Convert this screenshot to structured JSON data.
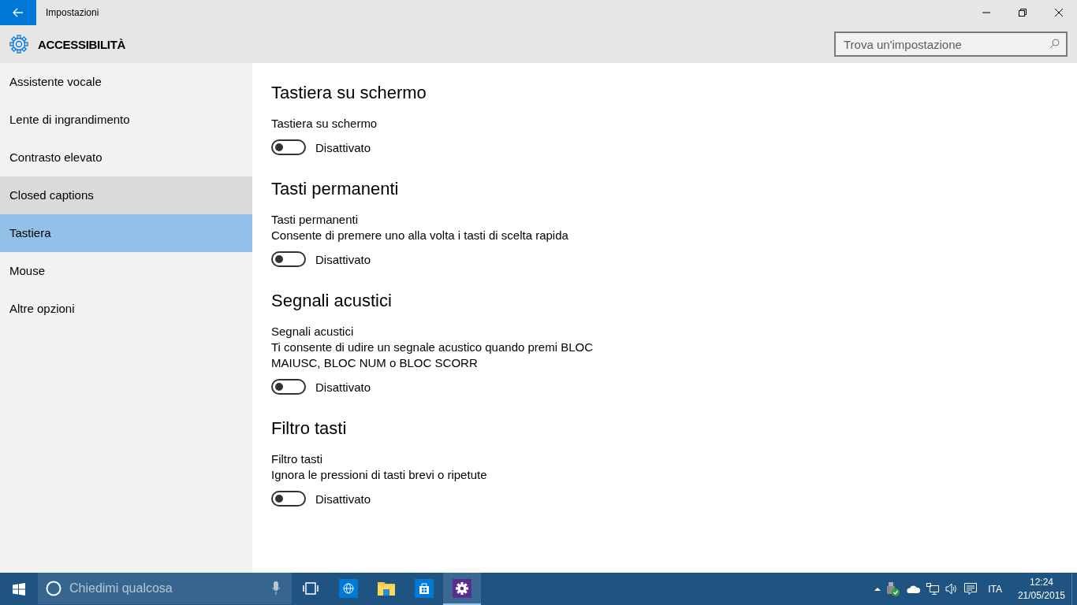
{
  "window": {
    "title": "Impostazioni"
  },
  "header": {
    "title": "ACCESSIBILITÀ",
    "search": {
      "placeholder": "Trova un'impostazione"
    }
  },
  "sidebar": {
    "items": [
      {
        "label": "Assistente vocale",
        "selected": false,
        "hovered": false
      },
      {
        "label": "Lente di ingrandimento",
        "selected": false,
        "hovered": false
      },
      {
        "label": "Contrasto elevato",
        "selected": false,
        "hovered": false
      },
      {
        "label": "Closed captions",
        "selected": false,
        "hovered": true
      },
      {
        "label": "Tastiera",
        "selected": true,
        "hovered": false
      },
      {
        "label": "Mouse",
        "selected": false,
        "hovered": false
      },
      {
        "label": "Altre opzioni",
        "selected": false,
        "hovered": false
      }
    ]
  },
  "sections": [
    {
      "heading": "Tastiera su schermo",
      "label": "Tastiera su schermo",
      "toggle": {
        "on": false,
        "state": "Disattivato"
      }
    },
    {
      "heading": "Tasti permanenti",
      "label": "Tasti permanenti",
      "description": "Consente di premere uno alla volta i tasti di scelta rapida",
      "toggle": {
        "on": false,
        "state": "Disattivato"
      }
    },
    {
      "heading": "Segnali acustici",
      "label": "Segnali acustici",
      "description": "Ti consente di udire un segnale acustico quando premi BLOC MAIUSC, BLOC NUM o BLOC SCORR",
      "toggle": {
        "on": false,
        "state": "Disattivato"
      }
    },
    {
      "heading": "Filtro tasti",
      "label": "Filtro tasti",
      "description": "Ignora le pressioni di tasti brevi o ripetute",
      "toggle": {
        "on": false,
        "state": "Disattivato"
      }
    }
  ],
  "taskbar": {
    "search": {
      "placeholder": "Chiedimi qualcosa"
    },
    "apps": [
      {
        "kind": "globe",
        "active": false
      },
      {
        "kind": "folder",
        "active": false
      },
      {
        "kind": "store",
        "active": false
      },
      {
        "kind": "settings",
        "active": true
      }
    ],
    "language": "ITA",
    "time": "12:24",
    "date": "21/05/2015"
  }
}
